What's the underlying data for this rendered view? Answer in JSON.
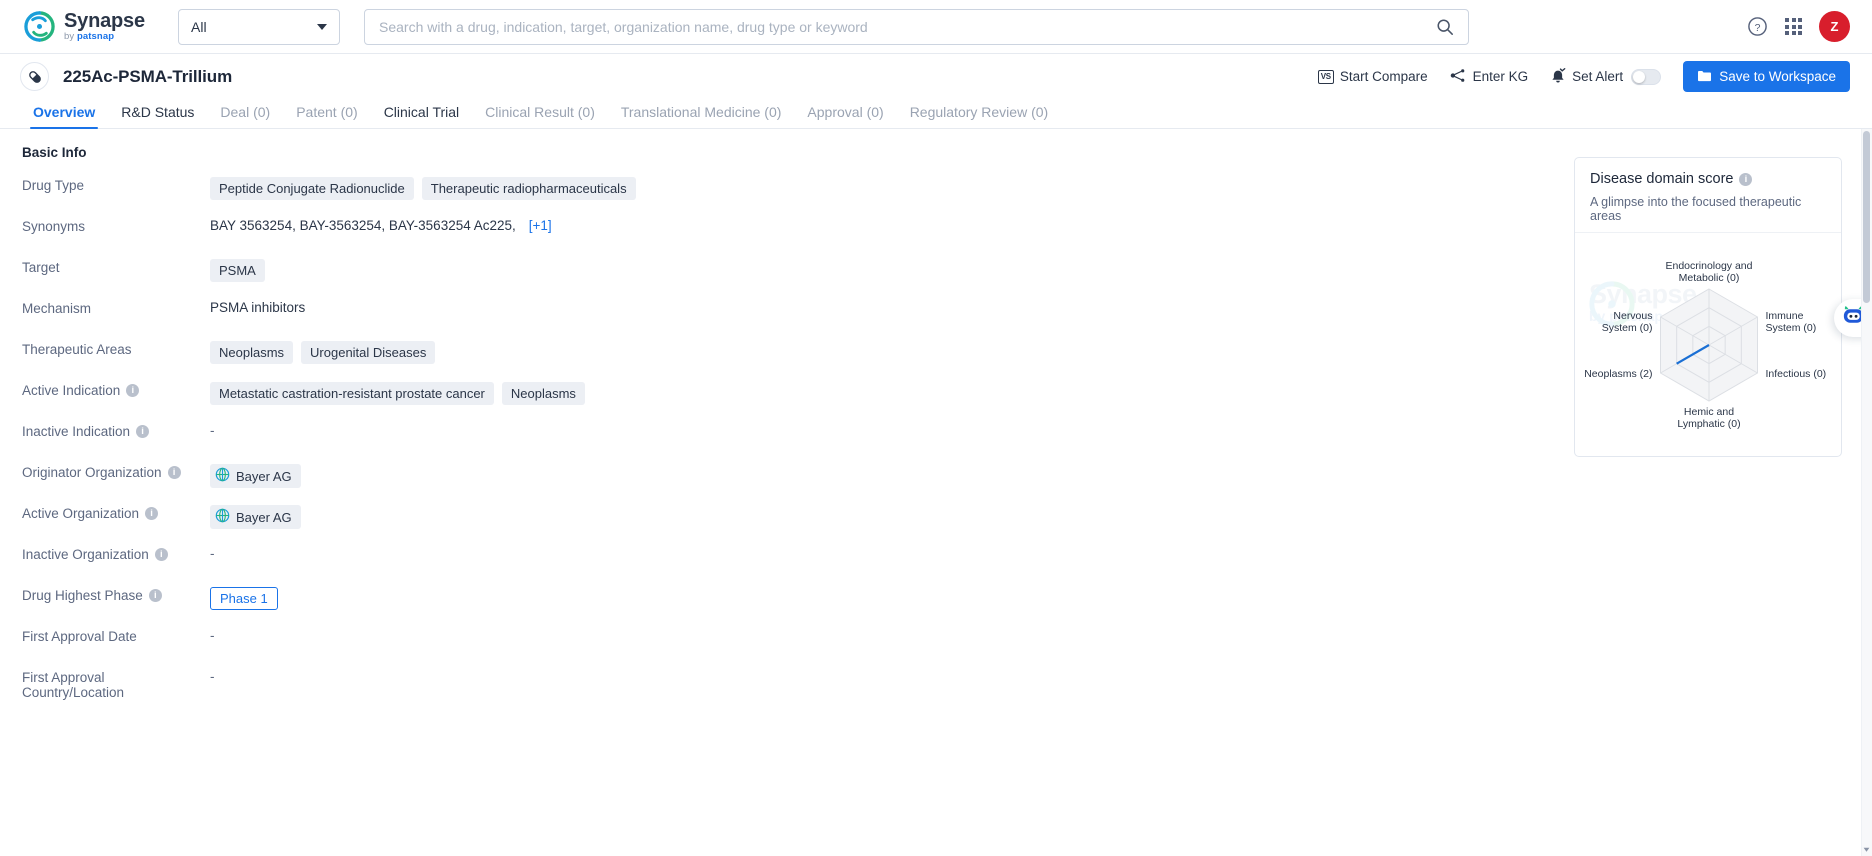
{
  "topbar": {
    "brand_name": "Synapse",
    "brand_sub_prefix": "by ",
    "brand_sub_name": "patsnap",
    "scope_value": "All",
    "search_placeholder": "Search with a drug, indication, target, organization name, drug type or keyword",
    "search_value": "",
    "avatar_initial": "Z",
    "accent_blue": "#1a73e8",
    "avatar_red": "#d81e2c"
  },
  "drug_header": {
    "title": "225Ac-PSMA-Trillium",
    "actions": {
      "compare_badge": "VS",
      "compare_label": "Start Compare",
      "kg_label": "Enter KG",
      "alert_label": "Set Alert",
      "alert_toggle_state": "off",
      "save_label": "Save to Workspace"
    }
  },
  "tabs": [
    {
      "label": "Overview",
      "state": "active"
    },
    {
      "label": "R&D Status",
      "state": "enabled"
    },
    {
      "label": "Deal (0)",
      "state": "disabled"
    },
    {
      "label": "Patent (0)",
      "state": "disabled"
    },
    {
      "label": "Clinical Trial",
      "state": "enabled"
    },
    {
      "label": "Clinical Result (0)",
      "state": "disabled"
    },
    {
      "label": "Translational Medicine (0)",
      "state": "disabled"
    },
    {
      "label": "Approval (0)",
      "state": "disabled"
    },
    {
      "label": "Regulatory Review (0)",
      "state": "disabled"
    }
  ],
  "basic_info": {
    "section_title": "Basic Info",
    "rows": [
      {
        "label": "Drug Type",
        "has_info": false,
        "type": "chips",
        "chips": [
          "Peptide Conjugate Radionuclide",
          "Therapeutic radiopharmaceuticals"
        ]
      },
      {
        "label": "Synonyms",
        "has_info": false,
        "type": "synonyms",
        "text": "BAY 3563254,  BAY-3563254,  BAY-3563254 Ac225,",
        "more": "[+1]"
      },
      {
        "label": "Target",
        "has_info": false,
        "type": "chips",
        "chips": [
          "PSMA"
        ]
      },
      {
        "label": "Mechanism",
        "has_info": false,
        "type": "plain",
        "text": "PSMA inhibitors"
      },
      {
        "label": "Therapeutic Areas",
        "has_info": false,
        "type": "chips",
        "chips": [
          "Neoplasms",
          "Urogenital Diseases"
        ]
      },
      {
        "label": "Active Indication",
        "has_info": true,
        "type": "chips",
        "chips": [
          "Metastatic castration-resistant prostate cancer",
          "Neoplasms"
        ]
      },
      {
        "label": "Inactive Indication",
        "has_info": true,
        "type": "dash",
        "text": "-"
      },
      {
        "label": "Originator Organization",
        "has_info": true,
        "type": "org",
        "chips": [
          "Bayer AG"
        ]
      },
      {
        "label": "Active Organization",
        "has_info": true,
        "type": "org",
        "chips": [
          "Bayer AG"
        ]
      },
      {
        "label": "Inactive Organization",
        "has_info": true,
        "type": "dash",
        "text": "-"
      },
      {
        "label": "Drug Highest Phase",
        "has_info": true,
        "type": "phase",
        "text": "Phase 1"
      },
      {
        "label": "First Approval Date",
        "has_info": false,
        "type": "dash",
        "text": "-"
      },
      {
        "label": "First Approval Country/Location",
        "has_info": false,
        "type": "dash",
        "text": "-"
      }
    ]
  },
  "score_card": {
    "title": "Disease domain score",
    "subtitle": "A glimpse into the focused therapeutic areas",
    "watermark_text": "Synapse",
    "watermark_sub": "by patsnap"
  },
  "chart_data": {
    "type": "radar",
    "title": "Disease domain score",
    "subtitle": "A glimpse into the focused therapeutic areas",
    "categories": [
      "Endocrinology and Metabolic (0)",
      "Immune System (0)",
      "Infectious (0)",
      "Hemic and Lymphatic (0)",
      "Neoplasms (2)",
      "Nervous System (0)"
    ],
    "axis_labels": [
      {
        "name": "Endocrinology and Metabolic",
        "value": 0,
        "position": "top"
      },
      {
        "name": "Immune System",
        "value": 0,
        "position": "top-right"
      },
      {
        "name": "Infectious",
        "value": 0,
        "position": "bottom-right"
      },
      {
        "name": "Hemic and Lymphatic",
        "value": 0,
        "position": "bottom"
      },
      {
        "name": "Neoplasms",
        "value": 2,
        "position": "bottom-left"
      },
      {
        "name": "Nervous System",
        "value": 0,
        "position": "top-left"
      }
    ],
    "values": [
      0,
      0,
      0,
      0,
      2,
      0
    ],
    "rmax": 3,
    "grid_rings": 3,
    "grid": true,
    "legend": "none",
    "series_color": "#1a6fd4"
  },
  "chat": {
    "icon_label": "ai-assistant"
  },
  "scrollbar": {
    "position_percent": 2
  }
}
